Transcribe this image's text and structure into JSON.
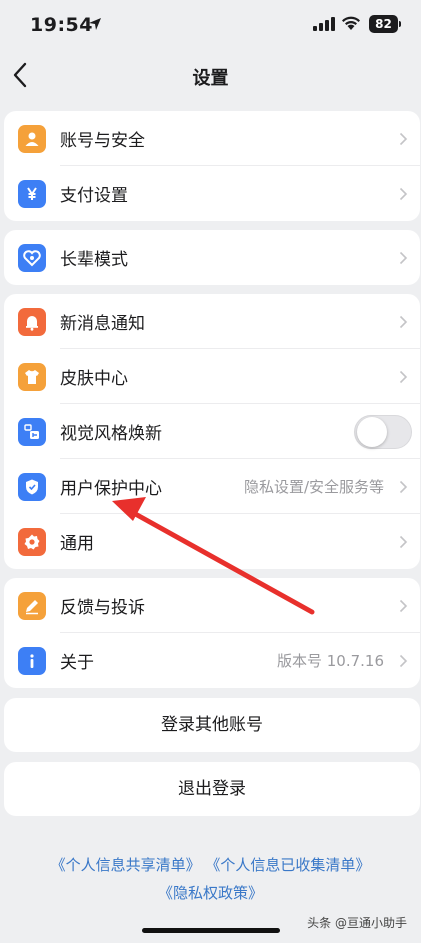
{
  "status_bar": {
    "time": "19:54",
    "battery": "82"
  },
  "nav": {
    "title": "设置"
  },
  "groups": [
    {
      "items": [
        {
          "label": "账号与安全",
          "icon": "person-icon",
          "color": "#f5a13a"
        },
        {
          "label": "支付设置",
          "icon": "yen-icon",
          "color": "#3d7ff5"
        }
      ]
    },
    {
      "items": [
        {
          "label": "长辈模式",
          "icon": "heart-icon",
          "color": "#3d7ff5"
        }
      ]
    },
    {
      "items": [
        {
          "label": "新消息通知",
          "icon": "bell-icon",
          "color": "#f26a3c"
        },
        {
          "label": "皮肤中心",
          "icon": "shirt-icon",
          "color": "#f5a13a"
        },
        {
          "label": "视觉风格焕新",
          "icon": "refresh-style-icon",
          "color": "#3d7ff5",
          "toggle": false
        },
        {
          "label": "用户保护中心",
          "icon": "shield-icon",
          "color": "#3d7ff5",
          "value": "隐私设置/安全服务等"
        },
        {
          "label": "通用",
          "icon": "gear-icon",
          "color": "#f26a3c"
        }
      ]
    },
    {
      "items": [
        {
          "label": "反馈与投诉",
          "icon": "pencil-icon",
          "color": "#f5a13a"
        },
        {
          "label": "关于",
          "icon": "info-icon",
          "color": "#3d7ff5",
          "value": "版本号 10.7.16"
        }
      ]
    }
  ],
  "buttons": {
    "login_other": "登录其他账号",
    "logout": "退出登录"
  },
  "links": {
    "shared_list": "《个人信息共享清单》",
    "collected_list": "《个人信息已收集清单》",
    "privacy_policy": "《隐私权政策》"
  },
  "watermark": "头条 @亘通小助手",
  "colors": {
    "accent_blue": "#3d7ff5",
    "accent_orange": "#f5a13a",
    "accent_red": "#f26a3c",
    "link": "#3a78c8",
    "annotation_arrow": "#e8302c"
  }
}
